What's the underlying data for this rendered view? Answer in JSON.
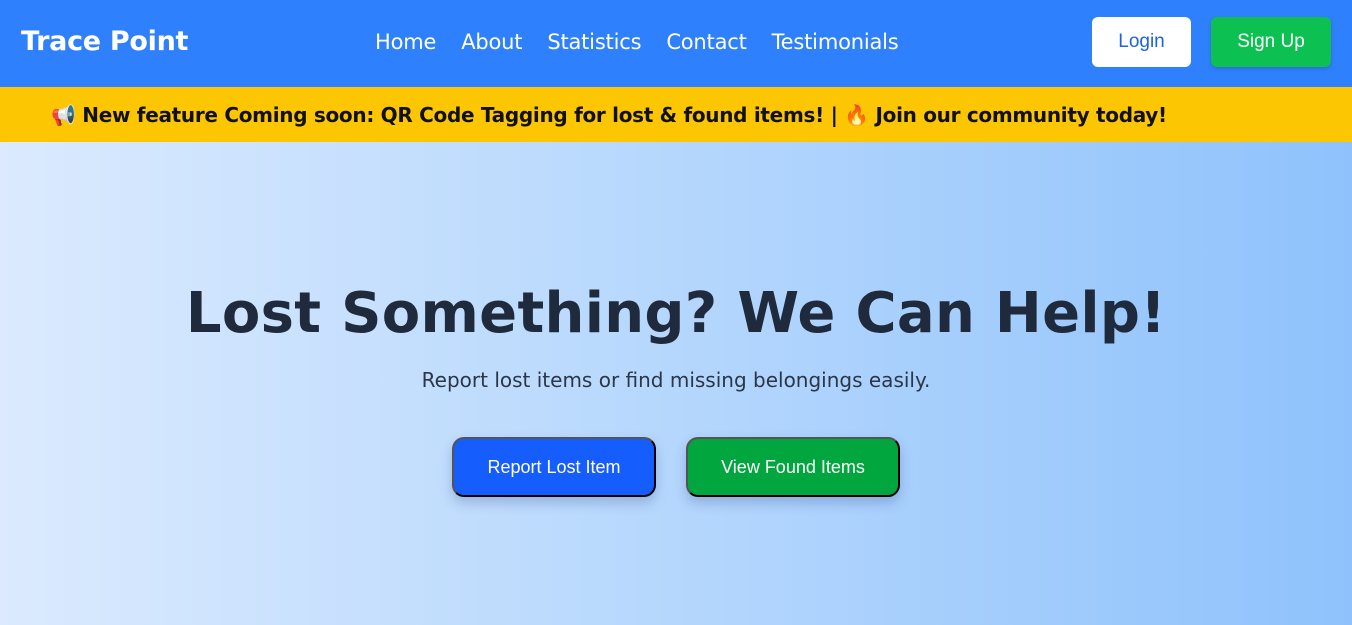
{
  "navbar": {
    "brand": "Trace Point",
    "links": [
      "Home",
      "About",
      "Statistics",
      "Contact",
      "Testimonials"
    ],
    "login_label": "Login",
    "signup_label": "Sign Up"
  },
  "announcement": {
    "text": "📢 New feature Coming soon: QR Code Tagging for lost & found items! | 🔥 Join our community today!"
  },
  "hero": {
    "title": "Lost Something? We Can Help!",
    "subtitle": "Report lost items or find missing belongings easily.",
    "report_button": "Report Lost Item",
    "view_button": "View Found Items"
  },
  "colors": {
    "navbar_bg": "#2f80fd",
    "announcement_bg": "#fcc603",
    "signup_bg": "#0cc151",
    "report_bg": "#155dfc",
    "view_bg": "#02a63f"
  }
}
